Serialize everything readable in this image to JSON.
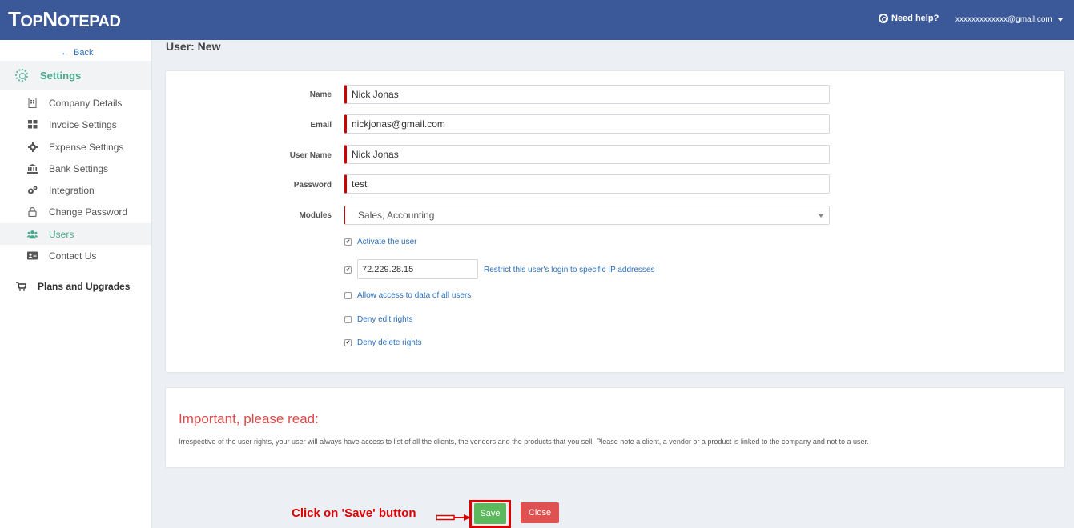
{
  "app": {
    "logo_big": "T",
    "logo_rest1": "OP",
    "logo_big2": "N",
    "logo_rest2": "OTEPAD"
  },
  "header": {
    "help_label": "Need help?",
    "account_email": "xxxxxxxxxxxxx@gmail.com"
  },
  "sidebar": {
    "back_label": "Back",
    "settings_label": "Settings",
    "items": [
      {
        "label": "Company Details",
        "icon": "building-icon"
      },
      {
        "label": "Invoice Settings",
        "icon": "grid-icon"
      },
      {
        "label": "Expense Settings",
        "icon": "gear-icon"
      },
      {
        "label": "Bank Settings",
        "icon": "bank-icon"
      },
      {
        "label": "Integration",
        "icon": "cogs-icon"
      },
      {
        "label": "Change Password",
        "icon": "lock-icon"
      },
      {
        "label": "Users",
        "icon": "users-icon"
      },
      {
        "label": "Contact Us",
        "icon": "contact-card-icon"
      }
    ],
    "plans_label": "Plans and Upgrades"
  },
  "page": {
    "title": "User: New"
  },
  "form": {
    "name_label": "Name",
    "name_value": "Nick Jonas",
    "email_label": "Email",
    "email_value": "nickjonas@gmail.com",
    "username_label": "User Name",
    "username_value": "Nick Jonas",
    "password_label": "Password",
    "password_value": "test",
    "modules_label": "Modules",
    "modules_value": "Sales, Accounting",
    "activate_label": "Activate the user",
    "ip_value": "72.229.28.15",
    "ip_restrict_label": "Restrict this user's login to specific IP addresses",
    "allow_access_label": "Allow access to data of all users",
    "deny_edit_label": "Deny edit rights",
    "deny_delete_label": "Deny delete rights"
  },
  "info": {
    "title": "Important, please read:",
    "text": "Irrespective of the user rights, your user will always have access to list of all the clients, the vendors and the products that you sell. Please note a client, a vendor or a product is linked to the company and not to a user."
  },
  "annotation": {
    "instruction": "Click on 'Save' button"
  },
  "actions": {
    "save_label": "Save",
    "close_label": "Close"
  },
  "colors": {
    "topbar": "#3b5998",
    "accent": "#4aa88c",
    "save": "#5cb85c",
    "close": "#e05252",
    "alert": "#e04848"
  }
}
